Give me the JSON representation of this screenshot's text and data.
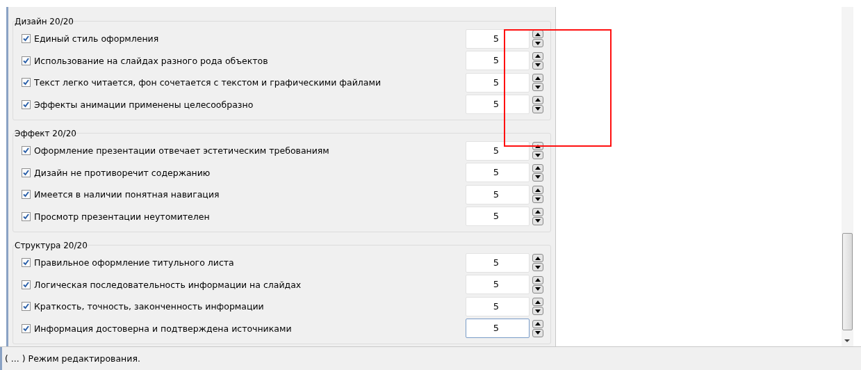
{
  "groups": [
    {
      "title": "Дизайн  20/20",
      "items": [
        {
          "label": "Единый стиль оформления",
          "checked": true,
          "value": "5",
          "focused": false
        },
        {
          "label": "Использование на слайдах разного рода объектов",
          "checked": true,
          "value": "5",
          "focused": false
        },
        {
          "label": "Текст легко читается, фон сочетается с текстом и графическими файлами",
          "checked": true,
          "value": "5",
          "focused": false
        },
        {
          "label": "Эффекты анимации применены целесообразно",
          "checked": true,
          "value": "5",
          "focused": false
        }
      ]
    },
    {
      "title": "Эффект  20/20",
      "items": [
        {
          "label": "Оформление презентации отвечает эстетическим требованиям",
          "checked": true,
          "value": "5",
          "focused": false
        },
        {
          "label": "Дизайн не противоречит содержанию",
          "checked": true,
          "value": "5",
          "focused": false
        },
        {
          "label": "Имеется в наличии понятная навигация",
          "checked": true,
          "value": "5",
          "focused": false
        },
        {
          "label": "Просмотр презентации неутомителен",
          "checked": true,
          "value": "5",
          "focused": false
        }
      ]
    },
    {
      "title": "Структура  20/20",
      "items": [
        {
          "label": "Правильное оформление титульного листа",
          "checked": true,
          "value": "5",
          "focused": false
        },
        {
          "label": "Логическая последовательность информации на слайдах",
          "checked": true,
          "value": "5",
          "focused": false
        },
        {
          "label": "Краткость, точность, законченность информации",
          "checked": true,
          "value": "5",
          "focused": false
        },
        {
          "label": "Информация достоверна и подтверждена источниками",
          "checked": true,
          "value": "5",
          "focused": true
        }
      ]
    }
  ],
  "highlight": {
    "kind": "rectangle"
  },
  "status_bar": "( ... ) Режим редактирования."
}
